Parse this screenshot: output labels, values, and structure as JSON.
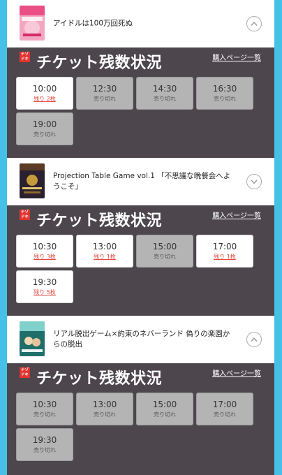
{
  "events": [
    {
      "title": "アイドルは100万回死ぬ",
      "thumb_text": "アイドルは100万回死ぬ",
      "panel": {
        "brand": "ナゾ ドキ",
        "title": "チケット残数状況",
        "buy_link": "購入ページ一覧"
      },
      "slots": [
        {
          "time": "10:00",
          "status": "残り 2枚"
        },
        {
          "time": "12:30",
          "status": "売り切れ"
        },
        {
          "time": "14:30",
          "status": "売り切れ"
        },
        {
          "time": "16:30",
          "status": "売り切れ"
        },
        {
          "time": "19:00",
          "status": "売り切れ"
        }
      ]
    },
    {
      "title": "Projection Table Game vol.1 「不思議な晩餐会へようこそ」",
      "thumb_text": "不思議な晩餐会へようこそ",
      "panel": {
        "brand": "ナゾ ドキ",
        "title": "チケット残数状況",
        "buy_link": "購入ページ一覧"
      },
      "slots": [
        {
          "time": "10:30",
          "status": "残り 3枚"
        },
        {
          "time": "13:00",
          "status": "残り 1枚"
        },
        {
          "time": "15:00",
          "status": "売り切れ"
        },
        {
          "time": "17:00",
          "status": "残り 1枚"
        },
        {
          "time": "19:30",
          "status": "残り 5枚"
        }
      ]
    },
    {
      "title": "リアル脱出ゲーム×約束のネバーランド 偽りの楽園からの脱出",
      "thumb_text": "偽りの楽園からの脱出",
      "panel": {
        "brand": "ナゾ ドキ",
        "title": "チケット残数状況",
        "buy_link": "購入ページ一覧"
      },
      "slots": [
        {
          "time": "10:30",
          "status": "売り切れ"
        },
        {
          "time": "13:00",
          "status": "売り切れ"
        },
        {
          "time": "15:00",
          "status": "売り切れ"
        },
        {
          "time": "17:00",
          "status": "売り切れ"
        },
        {
          "time": "19:30",
          "status": "売り切れ"
        }
      ]
    }
  ],
  "colors": {
    "page_background": "#45c1e8",
    "panel_background": "#4d474d",
    "sold_out_slot": "#b4b4b4",
    "available_slot": "#ffffff",
    "remaining_text": "#e24a3f",
    "brand_badge": "#e5322e"
  },
  "icons": {
    "toggle": "chevron-up-icon",
    "brand": "nazo-doki-logo"
  }
}
